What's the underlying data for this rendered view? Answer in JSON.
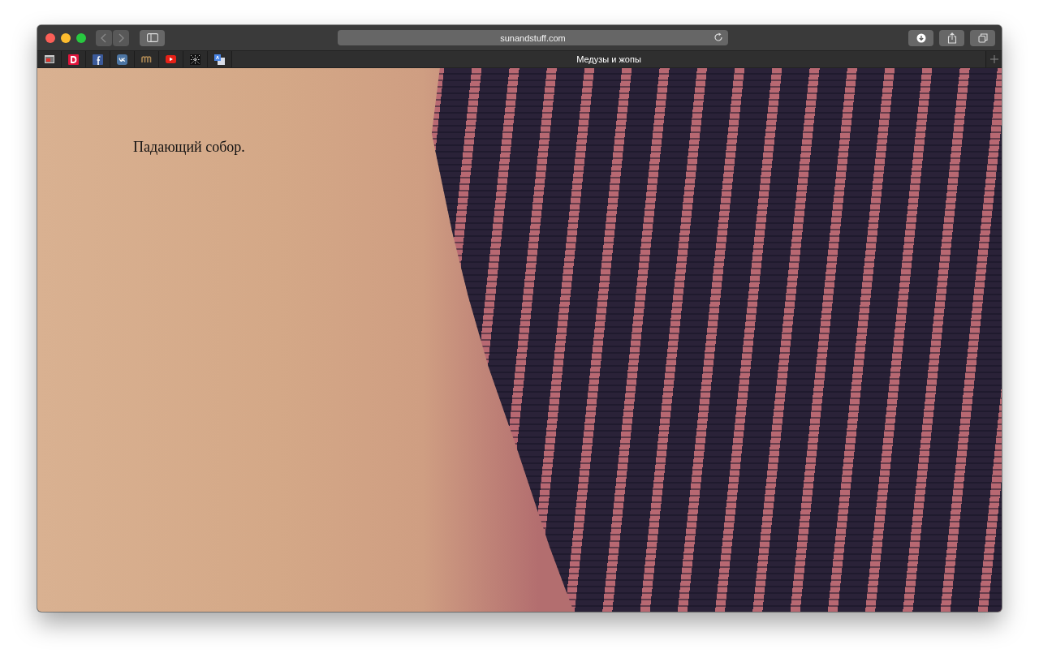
{
  "browser": {
    "url": "sunandstuff.com"
  },
  "tabs": [
    {
      "title": "Медузы и жопы",
      "selected": true
    }
  ],
  "page": {
    "caption": "Падающий собор."
  }
}
